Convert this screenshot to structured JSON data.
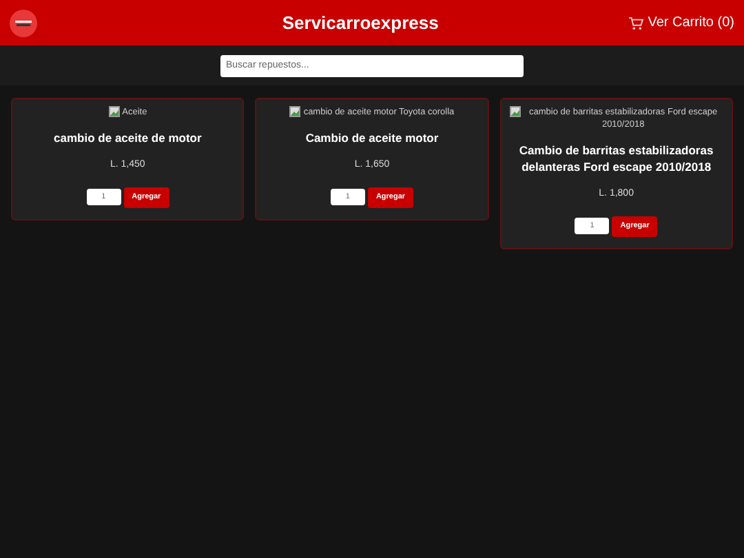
{
  "header": {
    "title": "Servicarroexpress",
    "cart_link": "Ver Carrito (0)"
  },
  "search": {
    "placeholder": "Buscar repuestos..."
  },
  "products": [
    {
      "image_alt": "Aceite",
      "name": "cambio de aceite de motor",
      "price": "L. 1,450",
      "quantity": "1",
      "button": "Agregar"
    },
    {
      "image_alt": "cambio de aceite motor Toyota corolla",
      "name": "Cambio de aceite motor",
      "price": "L. 1,650",
      "quantity": "1",
      "button": "Agregar"
    },
    {
      "image_alt": "cambio de barritas estabilizadoras Ford escape 2010/2018",
      "name": "Cambio de barritas estabilizadoras delanteras Ford escape 2010/2018",
      "price": "L. 1,800",
      "quantity": "1",
      "button": "Agregar"
    }
  ]
}
